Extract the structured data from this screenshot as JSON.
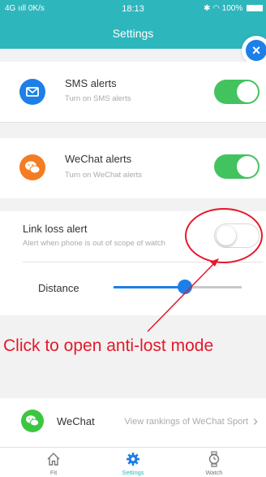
{
  "status_bar": {
    "network": "4G",
    "speed": "0K/s",
    "time": "18:13",
    "battery": "100%"
  },
  "header": {
    "title": "Settings"
  },
  "colors": {
    "header_bg": "#2eb6bd",
    "toggle_on": "#43c35e",
    "accent_blue": "#1d7fe8",
    "annotation_red": "#e5182a"
  },
  "settings": {
    "sms": {
      "title": "SMS alerts",
      "subtitle": "Turn on SMS alerts",
      "icon": "envelope-icon",
      "enabled": true
    },
    "wechat": {
      "title": "WeChat alerts",
      "subtitle": "Turn on WeChat alerts",
      "icon": "wechat-icon",
      "enabled": true
    },
    "link_loss": {
      "title": "Link loss alert",
      "subtitle": "Alert when phone is out of scope of watch",
      "enabled": false,
      "distance_label": "Distance",
      "distance_fraction": 0.56
    },
    "wechat_sport": {
      "title": "WeChat",
      "link": "View rankings of WeChat Sport",
      "icon": "wechat-icon"
    }
  },
  "annotation": {
    "text": "Click to open anti-lost mode"
  },
  "tabs": [
    {
      "label": "Fit",
      "icon": "home-icon",
      "active": false
    },
    {
      "label": "Settings",
      "icon": "gear-icon",
      "active": true
    },
    {
      "label": "Watch",
      "icon": "watch-icon",
      "active": false
    }
  ]
}
